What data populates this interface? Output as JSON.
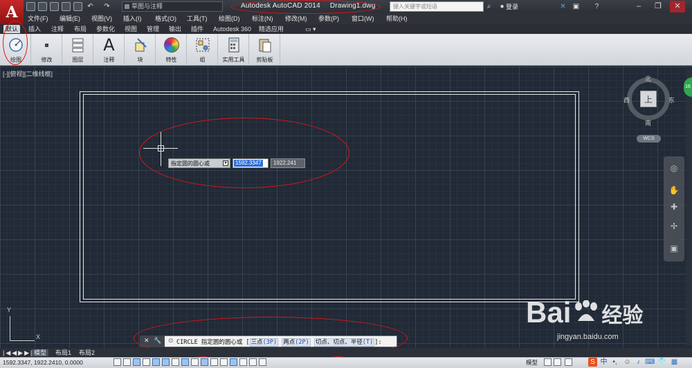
{
  "title_bar": {
    "workspace": "草图与注释",
    "app_title": "Autodesk AutoCAD 2014",
    "file_name": "Drawing1.dwg",
    "search_placeholder": "键入关键字或短语",
    "login_label": "登录"
  },
  "menu": [
    "文件(F)",
    "编辑(E)",
    "视图(V)",
    "插入(I)",
    "格式(O)",
    "工具(T)",
    "绘图(D)",
    "标注(N)",
    "修改(M)",
    "参数(P)",
    "窗口(W)",
    "帮助(H)"
  ],
  "ribbon_tabs": [
    "默认",
    "插入",
    "注释",
    "布局",
    "参数化",
    "视图",
    "管理",
    "输出",
    "插件",
    "Autodesk 360",
    "精选应用"
  ],
  "ribbon_buttons": [
    "绘图",
    "修改",
    "图层",
    "注释",
    "块",
    "特性",
    "组",
    "实用工具",
    "剪贴板"
  ],
  "viewport_label": "[-][俯视][二维线框]",
  "dynamic_input": {
    "prompt": "指定圆的圆心或",
    "x_value": "1592.3347",
    "y_value": "1922.241"
  },
  "viewcube": {
    "north": "北",
    "south": "南",
    "east": "东",
    "west": "西",
    "face": "上",
    "wcs": "WCS"
  },
  "ucs": {
    "y": "Y",
    "x": "X"
  },
  "command_line": {
    "command": "CIRCLE",
    "prompt": "指定圆的圆心或",
    "opt_3p_label": "三点",
    "opt_3p_key": "(3P)",
    "opt_2p_label": "两点",
    "opt_2p_key": "(2P)",
    "opt_ttr_label": "切点、切点、半径",
    "opt_ttr_key": "(T)",
    "open_bracket": "[",
    "close_bracket": "]:"
  },
  "layout_tabs": [
    "模型",
    "布局1",
    "布局2"
  ],
  "status": {
    "coords": "1592.3347,  1922.2410,  0.0000",
    "model": "模型",
    "ime_lang": "中"
  },
  "watermark": {
    "brand": "Bai",
    "brand2": "经验",
    "url": "jingyan.baidu.com"
  },
  "colors": {
    "annotation": "#e1141a",
    "canvas": "#212a36",
    "ribbon": "#dfe2e6",
    "selection": "#2f6fd6"
  },
  "icons": [
    "new-file-icon",
    "open-icon",
    "save-icon",
    "save-as-icon",
    "print-icon",
    "undo-icon",
    "redo-icon",
    "binoculars-icon",
    "user-icon",
    "exchange-icon",
    "help-icon"
  ]
}
